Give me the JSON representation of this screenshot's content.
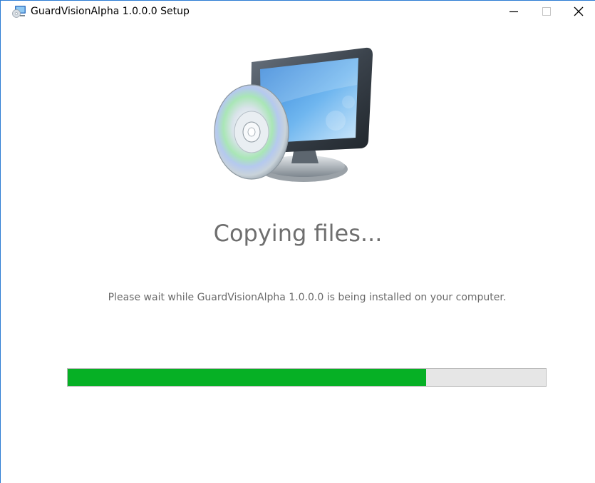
{
  "window": {
    "title": "GuardVisionAlpha 1.0.0.0 Setup",
    "app_icon": "installer-disk-icon",
    "caption_buttons": {
      "minimize": "minimize-icon",
      "maximize": "maximize-icon",
      "close": "close-icon"
    }
  },
  "main": {
    "hero_icon": "installer-computer-disc-icon",
    "heading": "Copying files...",
    "description": "Please wait while GuardVisionAlpha 1.0.0.0 is being installed on your computer.",
    "progress": {
      "fraction": 0.75,
      "fill_color": "#06b025",
      "track_color": "#e6e6e6"
    }
  }
}
